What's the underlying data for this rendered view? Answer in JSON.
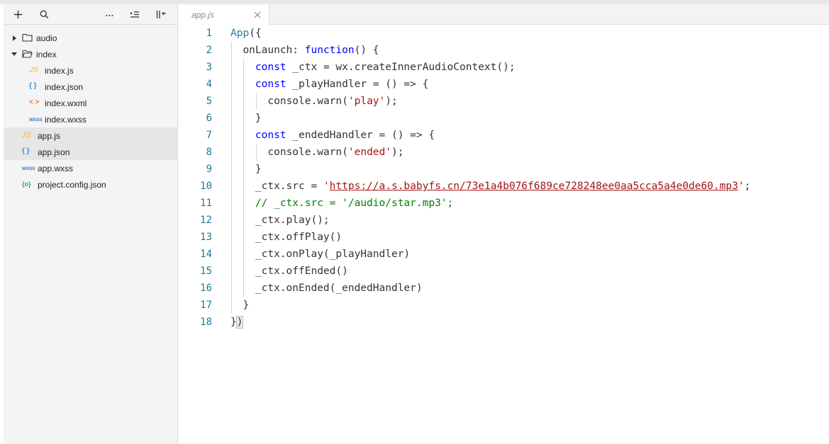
{
  "sidebar": {
    "toolbar": [
      "add-icon",
      "search-icon",
      "more-icon",
      "outline-icon",
      "collapse-icon"
    ],
    "tree": [
      {
        "label": "audio",
        "type": "folder",
        "expanded": false,
        "depth": 0
      },
      {
        "label": "index",
        "type": "folder",
        "expanded": true,
        "depth": 0
      },
      {
        "label": "index.js",
        "type": "js",
        "depth": 1,
        "icon_text": "JS"
      },
      {
        "label": "index.json",
        "type": "json",
        "depth": 1,
        "icon_text": "{ }"
      },
      {
        "label": "index.wxml",
        "type": "wxml",
        "depth": 1,
        "icon_text": "< >"
      },
      {
        "label": "index.wxss",
        "type": "wxss",
        "depth": 1,
        "icon_text": "WXSS"
      },
      {
        "label": "app.js",
        "type": "js",
        "depth": 0,
        "icon_text": "JS",
        "selected": true
      },
      {
        "label": "app.json",
        "type": "json",
        "depth": 0,
        "icon_text": "{ }",
        "selected": true
      },
      {
        "label": "app.wxss",
        "type": "wxss",
        "depth": 0,
        "icon_text": "WXSS"
      },
      {
        "label": "project.config.json",
        "type": "pcfg",
        "depth": 0,
        "icon_text": "{o}"
      }
    ]
  },
  "editor": {
    "tab": {
      "label": "app.js"
    },
    "line_numbers": [
      "1",
      "2",
      "3",
      "4",
      "5",
      "6",
      "7",
      "8",
      "9",
      "10",
      "11",
      "12",
      "13",
      "14",
      "15",
      "16",
      "17",
      "18"
    ],
    "lines": [
      {
        "indent": 0,
        "tokens": [
          {
            "t": "App",
            "c": "fn"
          },
          {
            "t": "(",
            "c": ""
          },
          {
            "t": "{",
            "c": ""
          }
        ]
      },
      {
        "indent": 1,
        "tokens": [
          {
            "t": "onLaunch: ",
            "c": ""
          },
          {
            "t": "function",
            "c": "kw"
          },
          {
            "t": "() {",
            "c": ""
          }
        ]
      },
      {
        "indent": 2,
        "tokens": [
          {
            "t": "const",
            "c": "kw"
          },
          {
            "t": " _ctx = wx.createInnerAudioContext();",
            "c": ""
          }
        ]
      },
      {
        "indent": 2,
        "tokens": [
          {
            "t": "const",
            "c": "kw"
          },
          {
            "t": " _playHandler = () => {",
            "c": ""
          }
        ]
      },
      {
        "indent": 3,
        "tokens": [
          {
            "t": "console.warn(",
            "c": ""
          },
          {
            "t": "'play'",
            "c": "str"
          },
          {
            "t": ");",
            "c": ""
          }
        ]
      },
      {
        "indent": 2,
        "tokens": [
          {
            "t": "}",
            "c": ""
          }
        ]
      },
      {
        "indent": 2,
        "tokens": [
          {
            "t": "const",
            "c": "kw"
          },
          {
            "t": " _endedHandler = () => {",
            "c": ""
          }
        ]
      },
      {
        "indent": 3,
        "tokens": [
          {
            "t": "console.warn(",
            "c": ""
          },
          {
            "t": "'ended'",
            "c": "str"
          },
          {
            "t": ");",
            "c": ""
          }
        ]
      },
      {
        "indent": 2,
        "tokens": [
          {
            "t": "}",
            "c": ""
          }
        ]
      },
      {
        "indent": 2,
        "tokens": [
          {
            "t": "_ctx.src = ",
            "c": ""
          },
          {
            "t": "'",
            "c": "str"
          },
          {
            "t": "https://a.s.babyfs.cn/73e1a4b076f689ce728248ee0aa5cca5a4e0de60.mp3",
            "c": "str url"
          },
          {
            "t": "'",
            "c": "str"
          },
          {
            "t": ";",
            "c": ""
          }
        ]
      },
      {
        "indent": 2,
        "tokens": [
          {
            "t": "// _ctx.src = '/audio/star.mp3';",
            "c": "cmt"
          }
        ]
      },
      {
        "indent": 2,
        "tokens": [
          {
            "t": "_ctx.play();",
            "c": ""
          }
        ]
      },
      {
        "indent": 2,
        "tokens": [
          {
            "t": "_ctx.offPlay()",
            "c": ""
          }
        ]
      },
      {
        "indent": 2,
        "tokens": [
          {
            "t": "_ctx.onPlay(_playHandler)",
            "c": ""
          }
        ]
      },
      {
        "indent": 2,
        "tokens": [
          {
            "t": "_ctx.offEnded()",
            "c": ""
          }
        ]
      },
      {
        "indent": 2,
        "tokens": [
          {
            "t": "_ctx.onEnded(_endedHandler)",
            "c": ""
          }
        ]
      },
      {
        "indent": 1,
        "tokens": [
          {
            "t": "}",
            "c": ""
          }
        ]
      },
      {
        "indent": 0,
        "tokens": [
          {
            "t": "}",
            "c": ""
          },
          {
            "t": ")",
            "c": "bracket-hl"
          }
        ]
      }
    ]
  }
}
